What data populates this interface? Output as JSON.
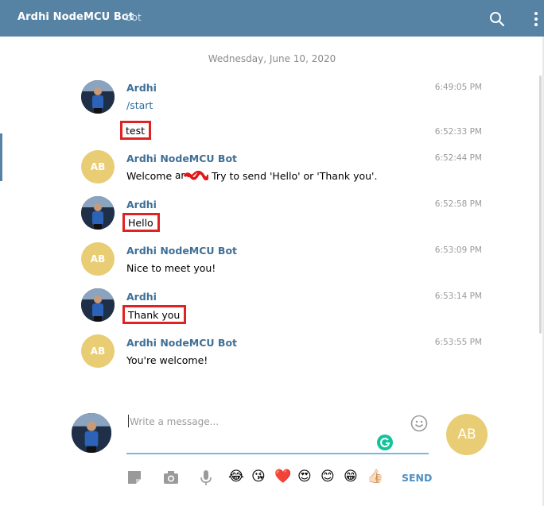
{
  "header": {
    "title": "Ardhi NodeMCU Bot",
    "subtitle": "bot",
    "icons": [
      "search-icon",
      "more-vertical-icon"
    ]
  },
  "date_separator": "Wednesday, June 10, 2020",
  "messages": [
    {
      "sender": "Ardhi",
      "avatar": "photo",
      "text": "/start",
      "time": "6:49:05 PM"
    },
    {
      "sender": "",
      "avatar": "",
      "text": "test",
      "time": "6:52:33 PM",
      "highlighted": true
    },
    {
      "sender": "Ardhi NodeMCU Bot",
      "avatar": "AB",
      "text_before": "Welcome ",
      "text_after": " Try to send 'Hello' or 'Thank you'.",
      "time": "6:52:44 PM"
    },
    {
      "sender": "Ardhi",
      "avatar": "photo",
      "text": "Hello",
      "time": "6:52:58 PM",
      "highlighted": true
    },
    {
      "sender": "Ardhi NodeMCU Bot",
      "avatar": "AB",
      "text": "Nice to meet you!",
      "time": "6:53:09 PM"
    },
    {
      "sender": "Ardhi",
      "avatar": "photo",
      "text": "Thank you",
      "time": "6:53:14 PM",
      "highlighted": true
    },
    {
      "sender": "Ardhi NodeMCU Bot",
      "avatar": "AB",
      "text": "You're welcome!",
      "time": "6:53:55 PM"
    }
  ],
  "composer": {
    "placeholder": "Write a message...",
    "send_label": "SEND",
    "peer_avatar": "AB",
    "tools": [
      "file-icon",
      "camera-icon",
      "microphone-icon"
    ],
    "emojis": [
      "😂",
      "😘",
      "❤️",
      "😍",
      "😊",
      "😁",
      "👍🏻"
    ]
  },
  "colors": {
    "header": "#5682a3",
    "name": "#3f6f97",
    "bot_avatar": "#e8cd75",
    "highlight_border": "#e12222"
  }
}
